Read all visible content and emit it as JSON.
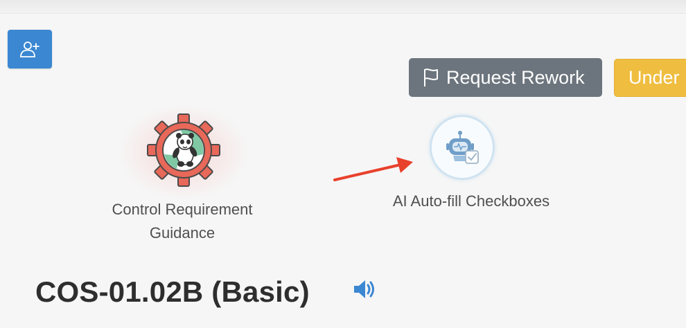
{
  "toolbar": {
    "request_rework_label": "Request Rework",
    "status_label": "Under"
  },
  "tools": {
    "guidance_label": "Control Requirement Guidance",
    "autofill_label": "AI Auto-fill Checkboxes"
  },
  "control": {
    "title": "COS-01.02B (Basic)"
  },
  "icons": {
    "assign": "add-user-icon",
    "rework": "flag-icon",
    "guidance": "gear-icon",
    "autofill": "robot-icon",
    "speaker": "speaker-icon",
    "annotation": "arrow-icon"
  },
  "colors": {
    "primary": "#3b87d2",
    "secondary": "#6c757d",
    "warning": "#efbd3f",
    "gear": "#e8685a",
    "annotation_arrow": "#e8412c"
  }
}
